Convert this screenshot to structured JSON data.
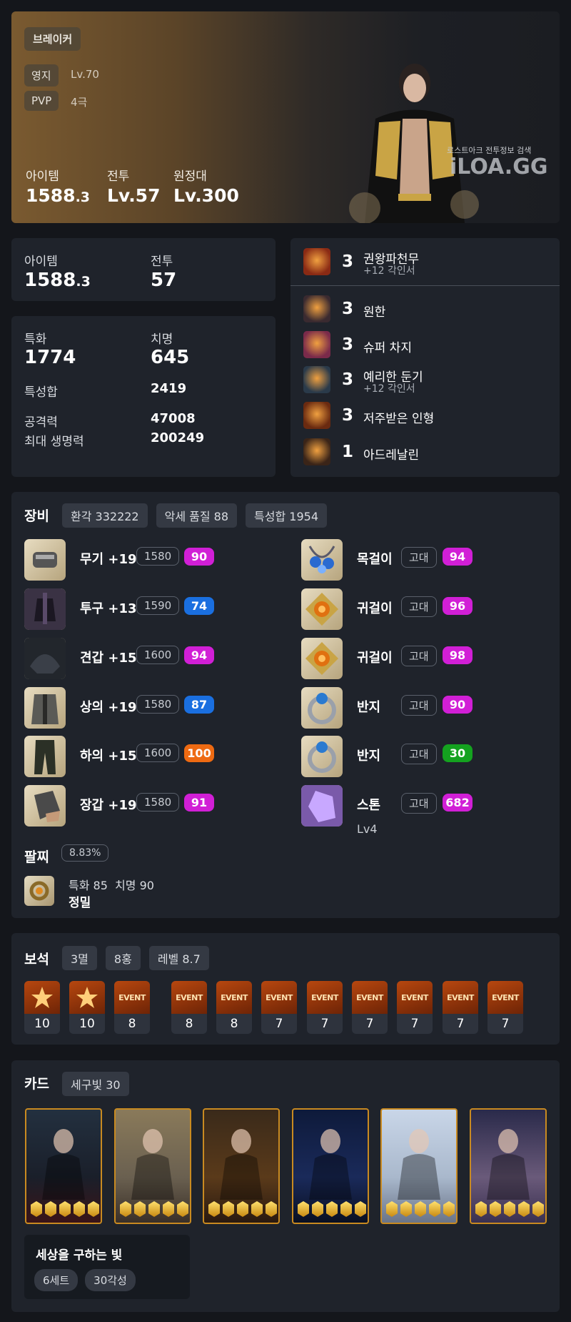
{
  "hero": {
    "class_name": "브레이커",
    "estate_label": "영지",
    "estate_value": "Lv.70",
    "pvp_label": "PVP",
    "pvp_value": "4극",
    "item_label": "아이템",
    "item_value": "1588",
    "item_decimal": ".3",
    "combat_label": "전투",
    "combat_value": "Lv.57",
    "expedition_label": "원정대",
    "expedition_value": "Lv.300",
    "watermark_caption": "로스트아크 전투정보 검색",
    "watermark_logo": "iLOA.GG"
  },
  "summary": {
    "item_label": "아이템",
    "item_value": "1588",
    "item_decimal": ".3",
    "combat_label": "전투",
    "combat_value": "57"
  },
  "stats": {
    "spec_label": "특화",
    "spec_value": "1774",
    "crit_label": "치명",
    "crit_value": "645",
    "total_label": "특성합",
    "total_value": "2419",
    "atk_label": "공격력",
    "atk_value": "47008",
    "hp_label": "최대 생명력",
    "hp_value": "200249"
  },
  "engravings": {
    "top": {
      "level": "3",
      "name": "권왕파천무",
      "sub": "+12 각인서",
      "icon": "flame-emblem-icon"
    },
    "list": [
      {
        "level": "3",
        "name": "원한",
        "sub": "",
        "icon": "grudge-icon"
      },
      {
        "level": "3",
        "name": "슈퍼 차지",
        "sub": "",
        "icon": "super-charge-icon"
      },
      {
        "level": "3",
        "name": "예리한 둔기",
        "sub": "+12 각인서",
        "icon": "keen-blunt-icon"
      },
      {
        "level": "3",
        "name": "저주받은 인형",
        "sub": "",
        "icon": "cursed-doll-icon"
      },
      {
        "level": "1",
        "name": "아드레날린",
        "sub": "",
        "icon": "adrenaline-icon"
      }
    ]
  },
  "equipment": {
    "title": "장비",
    "chips": [
      "환각 332222",
      "악세 품질 88",
      "특성합 1954"
    ],
    "left": [
      {
        "name": "무기 +19",
        "ilvl": "1580",
        "quality": "90",
        "color": "#d11fd6",
        "icon": "weapon-gauntlet-icon"
      },
      {
        "name": "투구 +13",
        "ilvl": "1590",
        "quality": "74",
        "color": "#1a6fe0",
        "icon": "helmet-icon"
      },
      {
        "name": "견갑 +15",
        "ilvl": "1600",
        "quality": "94",
        "color": "#d11fd6",
        "icon": "shoulder-icon"
      },
      {
        "name": "상의 +19",
        "ilvl": "1580",
        "quality": "87",
        "color": "#1a6fe0",
        "icon": "chest-icon"
      },
      {
        "name": "하의 +15",
        "ilvl": "1600",
        "quality": "100",
        "color": "#ee6a12",
        "icon": "pants-icon"
      },
      {
        "name": "장갑 +19",
        "ilvl": "1580",
        "quality": "91",
        "color": "#d11fd6",
        "icon": "gloves-icon"
      }
    ],
    "right": [
      {
        "name": "목걸이",
        "grade": "고대",
        "quality": "94",
        "color": "#d11fd6",
        "icon": "necklace-icon"
      },
      {
        "name": "귀걸이",
        "grade": "고대",
        "quality": "96",
        "color": "#d11fd6",
        "icon": "earring-icon"
      },
      {
        "name": "귀걸이",
        "grade": "고대",
        "quality": "98",
        "color": "#d11fd6",
        "icon": "earring-icon"
      },
      {
        "name": "반지",
        "grade": "고대",
        "quality": "90",
        "color": "#d11fd6",
        "icon": "ring-icon"
      },
      {
        "name": "반지",
        "grade": "고대",
        "quality": "30",
        "color": "#14a21f",
        "icon": "ring-icon"
      },
      {
        "name": "스톤",
        "grade": "고대",
        "quality": "682",
        "color": "#d11fd6",
        "icon": "ability-stone-icon",
        "extra": "Lv4"
      }
    ]
  },
  "bracelet": {
    "title": "팔찌",
    "percent": "8.83%",
    "stats": "특화 85  치명 90",
    "effect": "정밀",
    "icon": "bracelet-icon"
  },
  "gems": {
    "title": "보석",
    "chips": [
      "3멸",
      "8홍",
      "레벨 8.7"
    ],
    "items": [
      {
        "level": "10",
        "event": ""
      },
      {
        "level": "10",
        "event": ""
      },
      {
        "level": "8",
        "event": "EVENT"
      },
      {
        "level": "8",
        "event": "EVENT"
      },
      {
        "level": "8",
        "event": "EVENT"
      },
      {
        "level": "7",
        "event": "EVENT"
      },
      {
        "level": "7",
        "event": "EVENT"
      },
      {
        "level": "7",
        "event": "EVENT"
      },
      {
        "level": "7",
        "event": "EVENT"
      },
      {
        "level": "7",
        "event": "EVENT"
      },
      {
        "level": "7",
        "event": "EVENT"
      }
    ]
  },
  "cards": {
    "title": "카드",
    "chip": "세구빛 30",
    "items": [
      {
        "icon": "card-dark-warrior-icon",
        "awakening": 5
      },
      {
        "icon": "card-knight-icon",
        "awakening": 5
      },
      {
        "icon": "card-armored-giant-icon",
        "awakening": 5
      },
      {
        "icon": "card-shadow-knight-icon",
        "awakening": 5
      },
      {
        "icon": "card-angel-icon",
        "awakening": 5
      },
      {
        "icon": "card-twin-goddess-icon",
        "awakening": 5
      }
    ],
    "set_name": "세상을 구하는 빛",
    "set_chips": [
      "6세트",
      "30각성"
    ]
  }
}
